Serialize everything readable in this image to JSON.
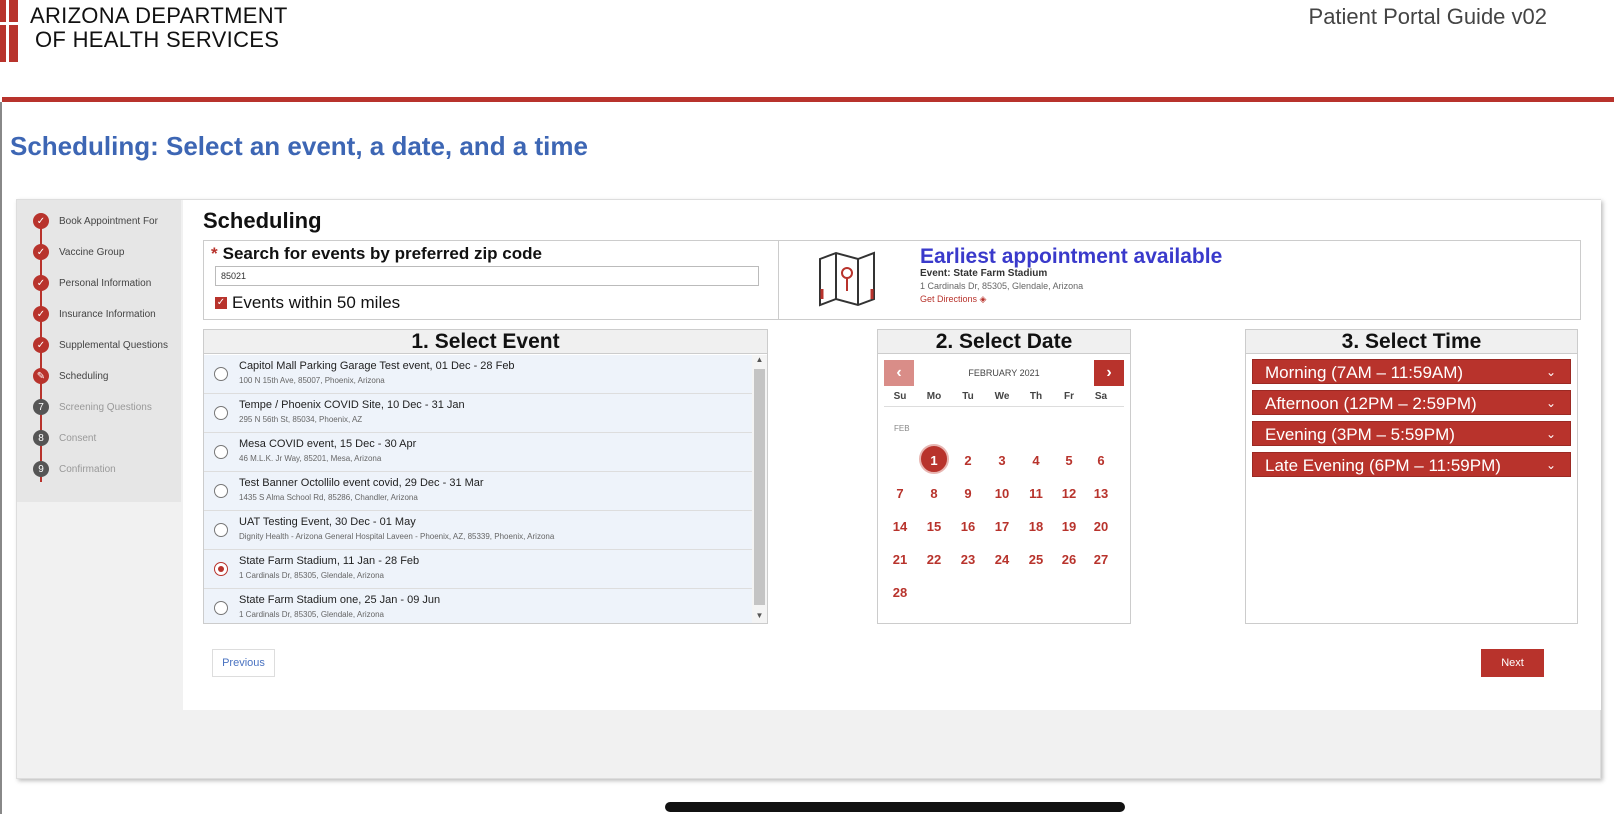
{
  "header": {
    "org_line1": "ARIZONA DEPARTMENT",
    "org_line2": "OF HEALTH SERVICES",
    "guide_title": "Patient Portal Guide v02",
    "slide_title": "Scheduling: Select an event, a date, and a time"
  },
  "colors": {
    "brand_red": "#b8332c",
    "link_blue": "#3d66b4",
    "earliest_blue": "#3a3acb"
  },
  "steps": [
    {
      "label": "Book Appointment For",
      "status": "done",
      "icon": "check-icon"
    },
    {
      "label": "Vaccine Group",
      "status": "done",
      "icon": "check-icon"
    },
    {
      "label": "Personal Information",
      "status": "done",
      "icon": "check-icon"
    },
    {
      "label": "Insurance Information",
      "status": "done",
      "icon": "check-icon"
    },
    {
      "label": "Supplemental Questions",
      "status": "done",
      "icon": "check-icon"
    },
    {
      "label": "Scheduling",
      "status": "current",
      "icon": "pencil-icon"
    },
    {
      "label": "Screening Questions",
      "status": "pending",
      "number": "7"
    },
    {
      "label": "Consent",
      "status": "pending",
      "number": "8"
    },
    {
      "label": "Confirmation",
      "status": "pending",
      "number": "9"
    }
  ],
  "content": {
    "title": "Scheduling",
    "search": {
      "required_mark": "*",
      "label": "Search for events by preferred zip code",
      "value": "85021",
      "within_label": "Events within 50 miles"
    },
    "earliest": {
      "title": "Earliest appointment available",
      "event": "Event: State Farm Stadium",
      "address": "1 Cardinals Dr, 85305, Glendale, Arizona",
      "directions": "Get Directions"
    }
  },
  "events_panel": {
    "header": "1. Select Event",
    "events": [
      {
        "name": "Capitol Mall Parking Garage Test event, 01 Dec - 28 Feb",
        "address": "100 N 15th Ave, 85007, Phoenix, Arizona"
      },
      {
        "name": "Tempe / Phoenix COVID Site, 10 Dec - 31 Jan",
        "address": "295 N 56th St, 85034, Phoenix, AZ"
      },
      {
        "name": "Mesa COVID event, 15 Dec - 30 Apr",
        "address": "46 M.L.K. Jr Way, 85201, Mesa, Arizona"
      },
      {
        "name": "Test Banner Octollilo event covid, 29 Dec - 31 Mar",
        "address": "1435 S Alma School Rd, 85286, Chandler, Arizona"
      },
      {
        "name": "UAT Testing Event, 30 Dec - 01 May",
        "address": "Dignity Health - Arizona General Hospital Laveen - Phoenix, AZ, 85339, Phoenix, Arizona"
      },
      {
        "name": "State Farm Stadium, 11 Jan - 28 Feb",
        "address": "1 Cardinals Dr, 85305, Glendale, Arizona",
        "selected": true
      },
      {
        "name": "State Farm Stadium one, 25 Jan - 09 Jun",
        "address": "1 Cardinals Dr, 85305, Glendale, Arizona"
      }
    ]
  },
  "date_panel": {
    "header": "2. Select Date",
    "month": "FEBRUARY 2021",
    "prev": "‹",
    "next": "›",
    "weekdays": [
      "Su",
      "Mo",
      "Tu",
      "We",
      "Th",
      "Fr",
      "Sa"
    ],
    "month_short": "FEB",
    "selected_day": 1
  },
  "time_panel": {
    "header": "3. Select Time",
    "slots": [
      "Morning  (7AM – 11:59AM)",
      "Afternoon  (12PM – 2:59PM)",
      "Evening (3PM – 5:59PM)",
      "Late Evening (6PM – 11:59PM)"
    ]
  },
  "buttons": {
    "previous": "Previous",
    "next": "Next"
  }
}
